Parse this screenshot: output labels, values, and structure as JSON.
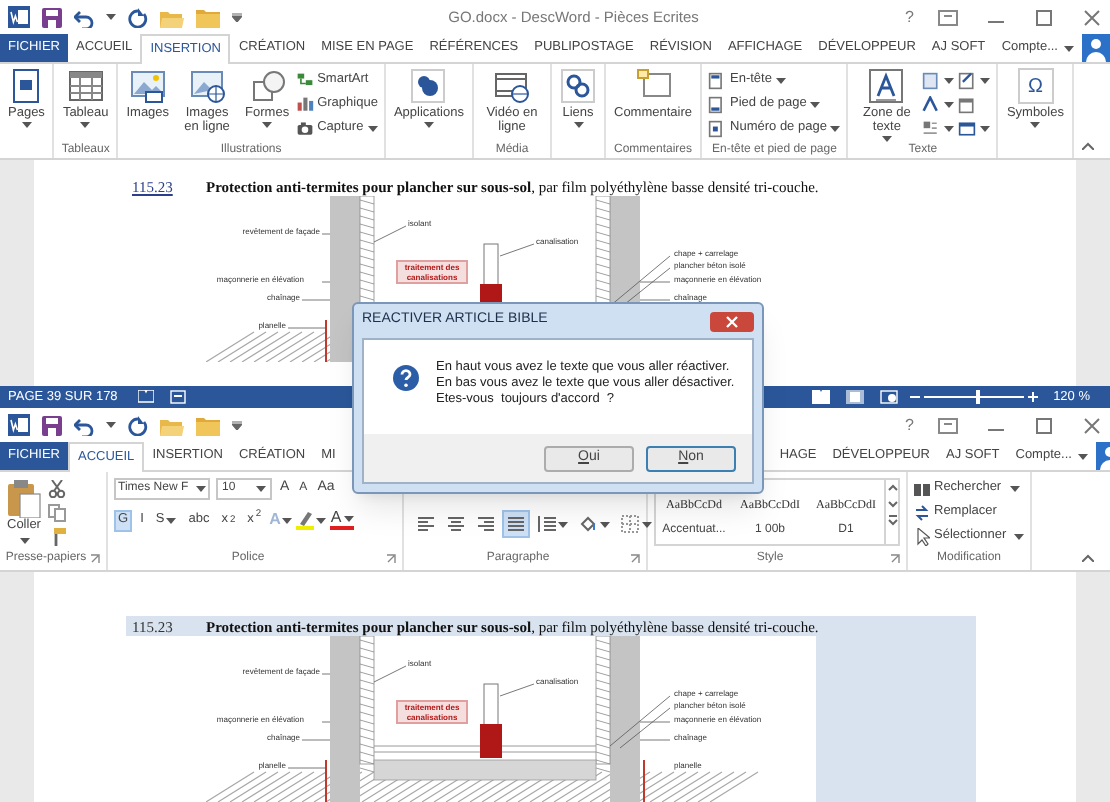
{
  "top_window": {
    "title": "GO.docx - DescWord - Pièces Ecrites",
    "help": "?",
    "tabs": [
      {
        "label": "FICHIER",
        "kind": "file",
        "selected": false
      },
      {
        "label": "ACCUEIL",
        "selected": false
      },
      {
        "label": "INSERTION",
        "selected": true
      },
      {
        "label": "CRÉATION",
        "selected": false
      },
      {
        "label": "MISE EN PAGE",
        "selected": false
      },
      {
        "label": "RÉFÉRENCES",
        "selected": false
      },
      {
        "label": "PUBLIPOSTAGE",
        "selected": false
      },
      {
        "label": "RÉVISION",
        "selected": false
      },
      {
        "label": "AFFICHAGE",
        "selected": false
      },
      {
        "label": "DÉVELOPPEUR",
        "selected": false
      },
      {
        "label": "AJ SOFT",
        "selected": false
      }
    ],
    "account": "Compte...",
    "ribbon_groups": [
      {
        "items": [
          {
            "kind": "large",
            "label": "Pages",
            "dropdown": true
          }
        ]
      },
      {
        "label": "Tableaux",
        "items": [
          {
            "kind": "large",
            "label": "Tableau",
            "dropdown": true
          }
        ]
      },
      {
        "label": "Illustrations",
        "items": [
          {
            "kind": "large",
            "label": "Images",
            "dropdown": false
          },
          {
            "kind": "large",
            "label": "Images en ligne",
            "dropdown": false
          },
          {
            "kind": "large",
            "label": "Formes",
            "dropdown": true
          },
          {
            "kind": "small",
            "label": "SmartArt",
            "dropdown": false
          },
          {
            "kind": "small",
            "label": "Graphique",
            "dropdown": false
          },
          {
            "kind": "small",
            "label": "Capture",
            "dropdown": true
          }
        ]
      },
      {
        "items": [
          {
            "kind": "large",
            "label": "Applications",
            "dropdown": true
          }
        ]
      },
      {
        "label": "Média",
        "items": [
          {
            "kind": "large",
            "label": "Vidéo en ligne",
            "dropdown": false
          }
        ]
      },
      {
        "items": [
          {
            "kind": "large",
            "label": "Liens",
            "dropdown": true
          }
        ]
      },
      {
        "label": "Commentaires",
        "items": [
          {
            "kind": "large",
            "label": "Commentaire",
            "dropdown": false
          }
        ]
      },
      {
        "label": "En-tête et pied de page",
        "items": [
          {
            "kind": "small",
            "label": "En-tête",
            "dropdown": true
          },
          {
            "kind": "small",
            "label": "Pied de page",
            "dropdown": true
          },
          {
            "kind": "small",
            "label": "Numéro de page",
            "dropdown": true
          }
        ]
      },
      {
        "label": "Texte",
        "items": [
          {
            "kind": "large",
            "label": "Zone de texte",
            "dropdown": true
          },
          {
            "kind": "small",
            "dropdown": true
          },
          {
            "kind": "small",
            "dropdown": true
          },
          {
            "kind": "small",
            "dropdown": true
          },
          {
            "kind": "small",
            "dropdown": true
          },
          {
            "kind": "small",
            "dropdown": false
          },
          {
            "kind": "small",
            "dropdown": true
          }
        ]
      },
      {
        "items": [
          {
            "kind": "large",
            "label": "Symboles",
            "glyph": "Ω",
            "dropdown": true
          }
        ]
      }
    ],
    "document": {
      "number": "115.23",
      "heading": "**Protection anti-termites pour plancher sur sous-sol**, par film polyéthylène basse densité tri-couche.",
      "highlighted": false,
      "drawing": {
        "left_labels": [
          "revêtement de façade",
          "maçonnerie en élévation",
          "chaînage",
          "planelle"
        ],
        "right_labels": [
          "chape + carrelage",
          "plancher béton isolé",
          "maçonnerie en élévation",
          "chaînage"
        ],
        "isolant": "isolant",
        "pipe": "canalisation",
        "callout": "traitement des canalisations"
      }
    },
    "status_bar": {
      "page": "PAGE 39 SUR 178",
      "zoom": "120 %",
      "zoom_slider": {
        "level": 0.55
      }
    }
  },
  "bottom_window": {
    "help": "?",
    "tabs": [
      {
        "label": "FICHIER",
        "kind": "file",
        "selected": false
      },
      {
        "label": "ACCUEIL",
        "selected": true
      },
      {
        "label": "INSERTION",
        "selected": false
      },
      {
        "label": "CRÉATION",
        "selected": false
      },
      {
        "label": "MI",
        "selected": false
      },
      {
        "label": "HAGE",
        "kind": "after_dialog",
        "selected": false
      },
      {
        "label": "DÉVELOPPEUR",
        "selected": false
      },
      {
        "label": "AJ SOFT",
        "selected": false
      }
    ],
    "account": "Compte...",
    "clipboard": {
      "label": "Presse-papiers",
      "paste": "Coller"
    },
    "font": {
      "label": "Police",
      "font_name": "Times New F",
      "font_size": "10",
      "size_buttons": [
        "A",
        "A",
        "Aa"
      ],
      "format_buttons": [
        {
          "label": "G",
          "selected": true
        },
        {
          "label": "I",
          "selected": false
        },
        {
          "label": "S",
          "selected": false,
          "dropdown": true
        },
        {
          "label": "abc",
          "selected": false
        },
        {
          "label": "x$_{2}$",
          "selected": false
        },
        {
          "label": "x$^{2}$",
          "selected": false
        }
      ],
      "color_buttons": [
        {
          "kind": "effects",
          "label": "A"
        },
        {
          "kind": "highlight"
        },
        {
          "kind": "font_color",
          "label": "A"
        }
      ]
    },
    "paragraph": {
      "label": "Paragraphe",
      "buttons": [
        {
          "kind": "align_left",
          "selected": false
        },
        {
          "kind": "align_center",
          "selected": false
        },
        {
          "kind": "align_right",
          "selected": false
        },
        {
          "kind": "justify",
          "selected": true
        },
        {
          "kind": "line_spacing",
          "selected": false
        },
        {
          "kind": "shading",
          "selected": false
        },
        {
          "kind": "borders",
          "selected": false
        }
      ]
    },
    "styles": {
      "label": "Style",
      "items": [
        {
          "sample": "AaBbCcDd",
          "name": "Accentuat..."
        },
        {
          "sample": "AaBbCcDdI",
          "name": "1 00b"
        },
        {
          "sample": "AaBbCcDdI",
          "name": "D1"
        }
      ]
    },
    "editing": {
      "label": "Modification",
      "items": [
        {
          "label": "Rechercher",
          "dropdown": true
        },
        {
          "label": "Remplacer",
          "dropdown": false
        },
        {
          "label": "Sélectionner",
          "dropdown": true
        }
      ]
    },
    "document": {
      "number": "115.23",
      "heading": "**Protection anti-termites pour plancher sur sous-sol**, par film polyéthylène basse densité tri-couche.",
      "highlighted": true,
      "drawing": {
        "left_labels": [
          "revêtement de façade",
          "maçonnerie en élévation",
          "chaînage",
          "planelle"
        ],
        "right_labels": [
          "chape + carrelage",
          "plancher béton isolé",
          "maçonnerie en élévation",
          "chaînage",
          "planelle"
        ],
        "isolant": "isolant",
        "pipe": "canalisation",
        "callout": "traitement des canalisations"
      }
    }
  },
  "dialog": {
    "title": "REACTIVER ARTICLE BIBLE",
    "message": [
      "En haut vous avez le texte que vous aller réactiver.",
      "En bas vous avez le texte que vous aller désactiver.",
      "Etes-vous  toujours d'accord  ?"
    ],
    "buttons": [
      {
        "label": "Oui",
        "default": false
      },
      {
        "label": "Non",
        "default": true
      }
    ]
  }
}
